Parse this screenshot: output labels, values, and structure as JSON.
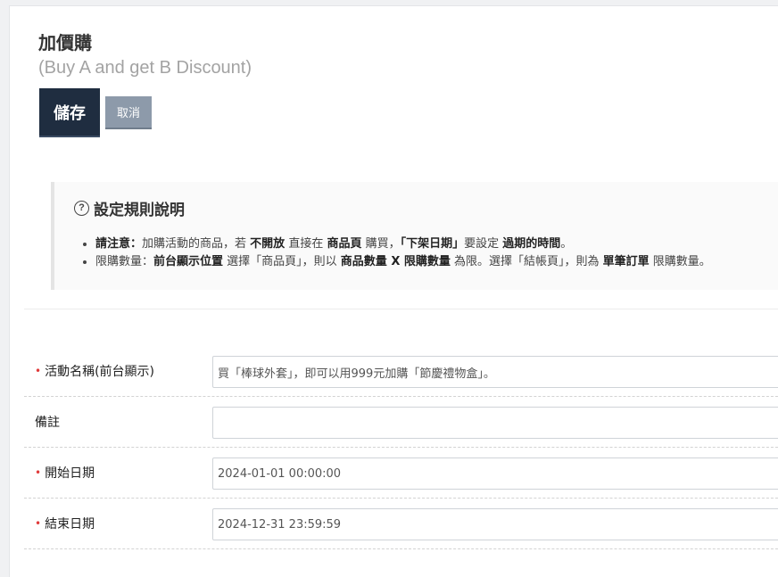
{
  "header": {
    "title": "加價購",
    "subtitle": "(Buy A and get B Discount)"
  },
  "actions": {
    "save_label": "儲存",
    "cancel_label": "取消"
  },
  "notice": {
    "title": "設定規則說明",
    "icon": "question-circle-icon",
    "item1": {
      "lead": "請注意",
      "colon": "：",
      "t1": "加購活動的商品，若 ",
      "b1": "不開放",
      "t2": " 直接在 ",
      "b2": "商品頁",
      "t3": " 購買，",
      "b3": "「下架日期」",
      "t4": "要設定 ",
      "b4": "過期的時間",
      "t5": "。"
    },
    "item2": {
      "t1": "限購數量：",
      "b1": "前台顯示位置",
      "t2": " 選擇「商品頁」，則以 ",
      "b2": "商品數量 X 限購數量",
      "t3": " 為限。選擇「結帳頁」，則為 ",
      "b3": "單筆訂單",
      "t4": " 限購數量。"
    }
  },
  "form": {
    "required_marker": "•",
    "rows": [
      {
        "label": "活動名稱(前台顯示)",
        "required": true,
        "value": "買「棒球外套」，即可以用999元加購「節慶禮物盒」。"
      },
      {
        "label": "備註",
        "required": false,
        "value": ""
      },
      {
        "label": "開始日期",
        "required": true,
        "value": "2024-01-01 00:00:00"
      },
      {
        "label": "結束日期",
        "required": true,
        "value": "2024-12-31 23:59:59"
      }
    ]
  },
  "colors": {
    "save_button": "#1f2d40",
    "cancel_button": "#8d9aaa",
    "required_marker": "#e03a3a"
  }
}
